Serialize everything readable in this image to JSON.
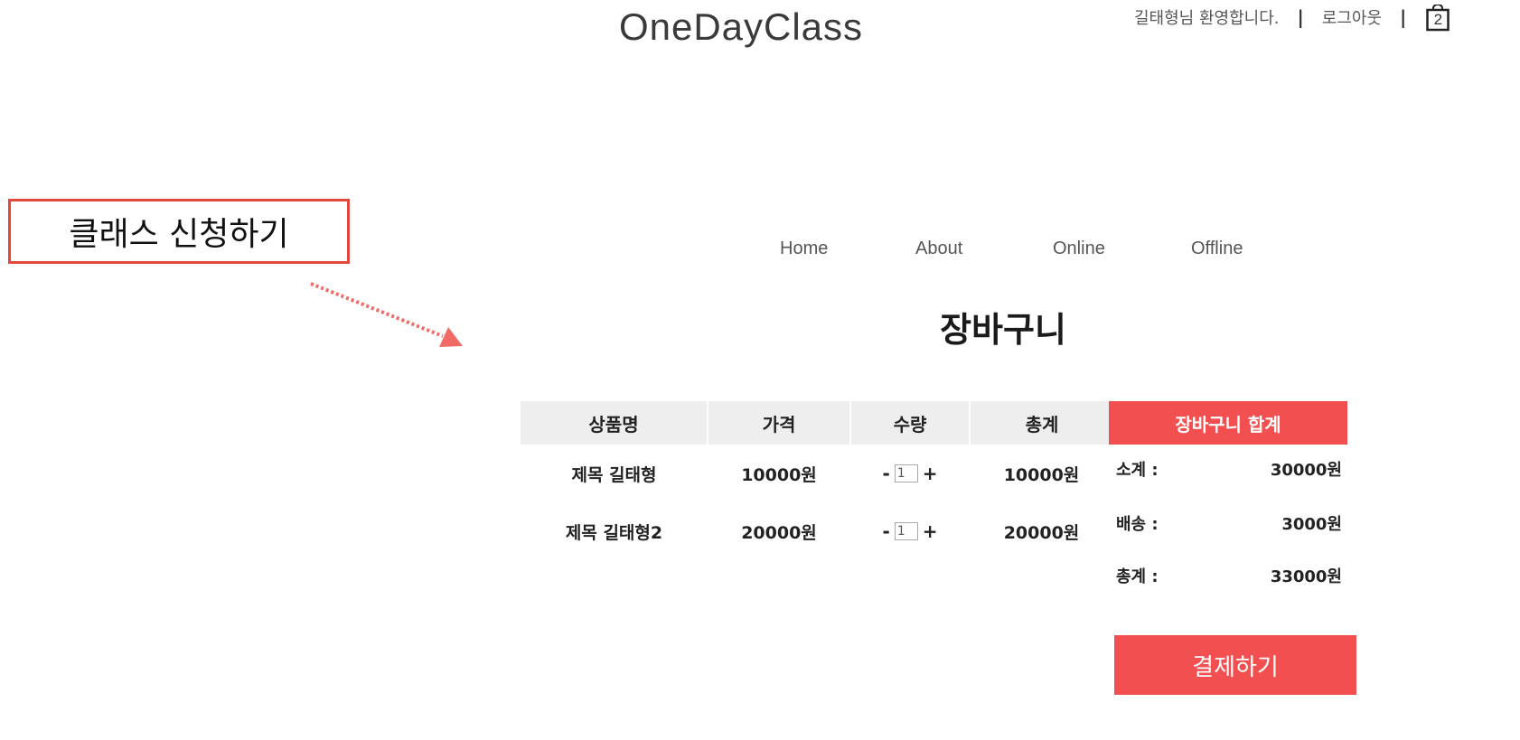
{
  "header": {
    "logo": "OneDayClass",
    "welcome": "길태형님 환영합니다.",
    "logout": "로그아웃",
    "separator": "|",
    "cart_count": "2"
  },
  "annotation": {
    "label": "클래스 신청하기",
    "color": "#e2483e",
    "arrow_color": "#f06a66"
  },
  "nav": {
    "items": [
      "Home",
      "About",
      "Online",
      "Offline"
    ]
  },
  "page_title": "장바구니",
  "cart_table": {
    "headers": [
      "상품명",
      "가격",
      "수량",
      "총계"
    ],
    "rows": [
      {
        "name": "제목 길태형",
        "price": "10000원",
        "qty": "1",
        "total": "10000원"
      },
      {
        "name": "제목 길태형2",
        "price": "20000원",
        "qty": "1",
        "total": "20000원"
      }
    ],
    "minus": "-",
    "plus": "+"
  },
  "summary": {
    "title": "장바구니 합계",
    "subtotal_label": "소계 :",
    "subtotal": "30000원",
    "shipping_label": "배송 :",
    "shipping": "3000원",
    "total_label": "총계 :",
    "total": "33000원",
    "checkout_label": "결제하기",
    "accent": "#f25050"
  }
}
